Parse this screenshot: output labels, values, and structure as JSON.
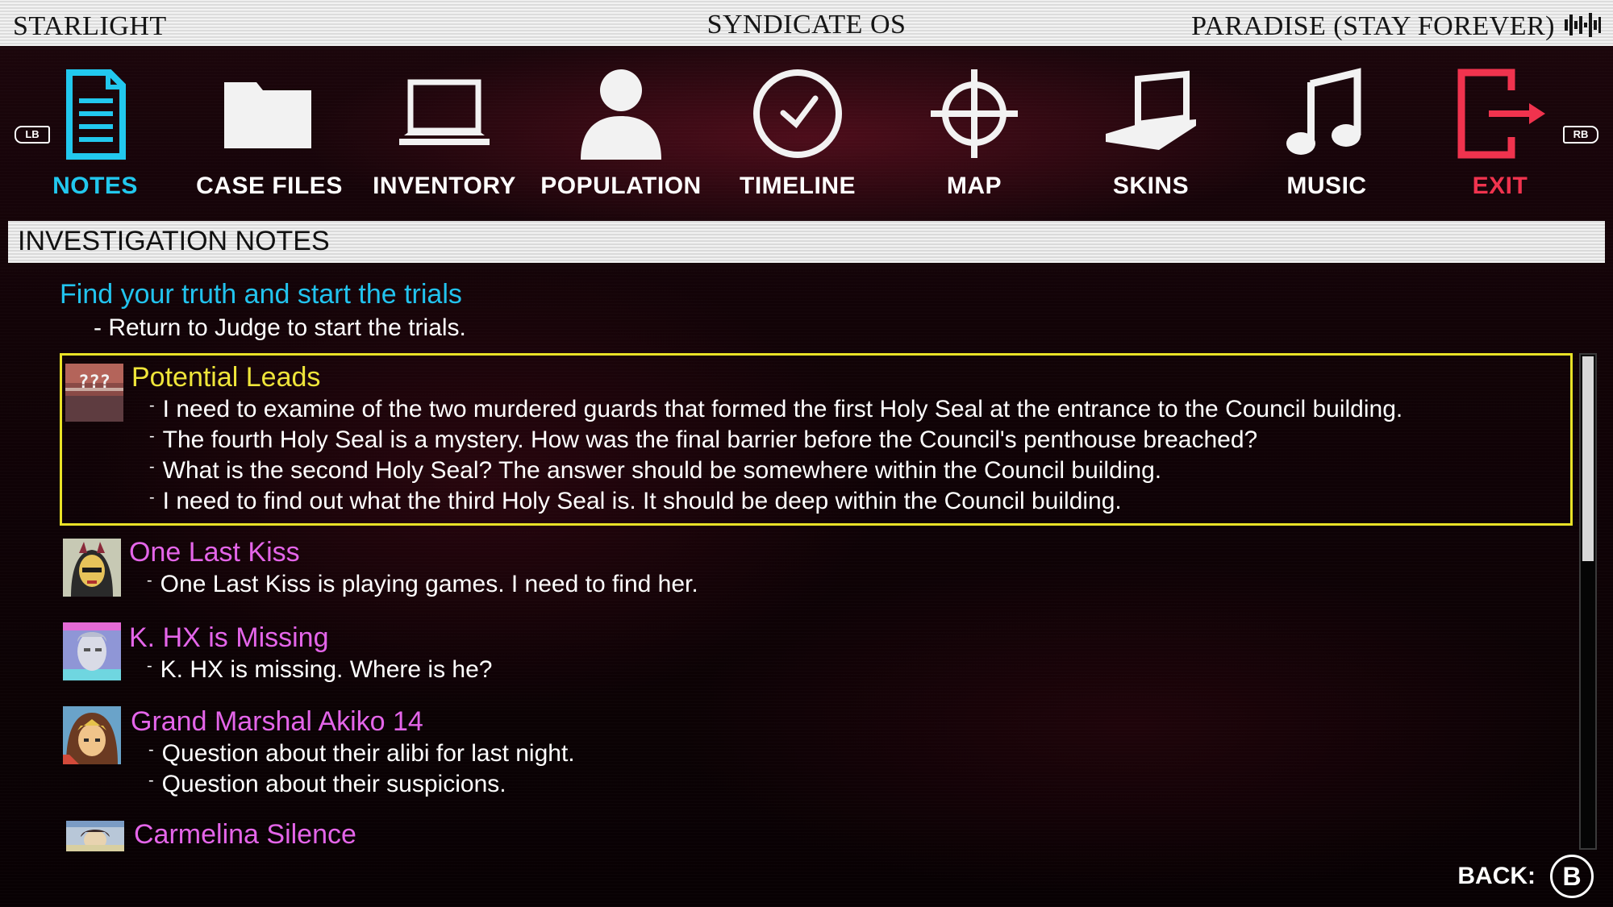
{
  "titlebar": {
    "left": "STARLIGHT",
    "center": "SYNDICATE OS",
    "right": "PARADISE (STAY FOREVER)",
    "right_icon": "audio-wave-icon"
  },
  "nav": {
    "lb": "LB",
    "rb": "RB",
    "items": [
      {
        "label": "NOTES",
        "icon": "notes-icon",
        "active": true
      },
      {
        "label": "CASE FILES",
        "icon": "folder-icon"
      },
      {
        "label": "INVENTORY",
        "icon": "laptop-icon"
      },
      {
        "label": "POPULATION",
        "icon": "person-icon"
      },
      {
        "label": "TIMELINE",
        "icon": "clock-icon"
      },
      {
        "label": "MAP",
        "icon": "crosshair-icon"
      },
      {
        "label": "SKINS",
        "icon": "skins-laptop-icon"
      },
      {
        "label": "MUSIC",
        "icon": "music-note-icon"
      },
      {
        "label": "EXIT",
        "icon": "exit-icon"
      }
    ]
  },
  "section": {
    "title": "INVESTIGATION NOTES"
  },
  "objective": {
    "title": "Find your truth and start the trials",
    "line": "- Return to Judge to start the trials."
  },
  "notes": [
    {
      "title": "Potential Leads",
      "selected": true,
      "portrait": "unknown-portrait",
      "lines": [
        "I need to examine of the two murdered guards that formed the first Holy Seal at the entrance to the Council building.",
        "The fourth Holy Seal is a mystery. How was the final barrier before the Council's penthouse breached?",
        "What is the second Holy Seal? The answer should be somewhere within the Council building.",
        "I need to find out what the third Holy Seal is. It should be deep within the Council building."
      ]
    },
    {
      "title": "One Last Kiss",
      "portrait": "one-last-kiss-portrait",
      "lines": [
        "One Last Kiss is playing games. I need to find her."
      ]
    },
    {
      "title": "K. HX is Missing",
      "portrait": "k-hx-portrait",
      "lines": [
        "K. HX is missing. Where is he?"
      ]
    },
    {
      "title": "Grand Marshal Akiko 14",
      "portrait": "akiko-portrait",
      "lines": [
        "Question about their alibi for last night.",
        "Question about their suspicions."
      ]
    },
    {
      "title": "Carmelina Silence",
      "portrait": "carmelina-portrait",
      "lines": []
    }
  ],
  "colors": {
    "active": "#22c8ee",
    "exit": "#f0334e",
    "selected_title": "#efe53a",
    "note_title": "#e465e9",
    "selection_border": "#e9e227"
  },
  "back": {
    "label": "BACK:",
    "button": "B"
  }
}
